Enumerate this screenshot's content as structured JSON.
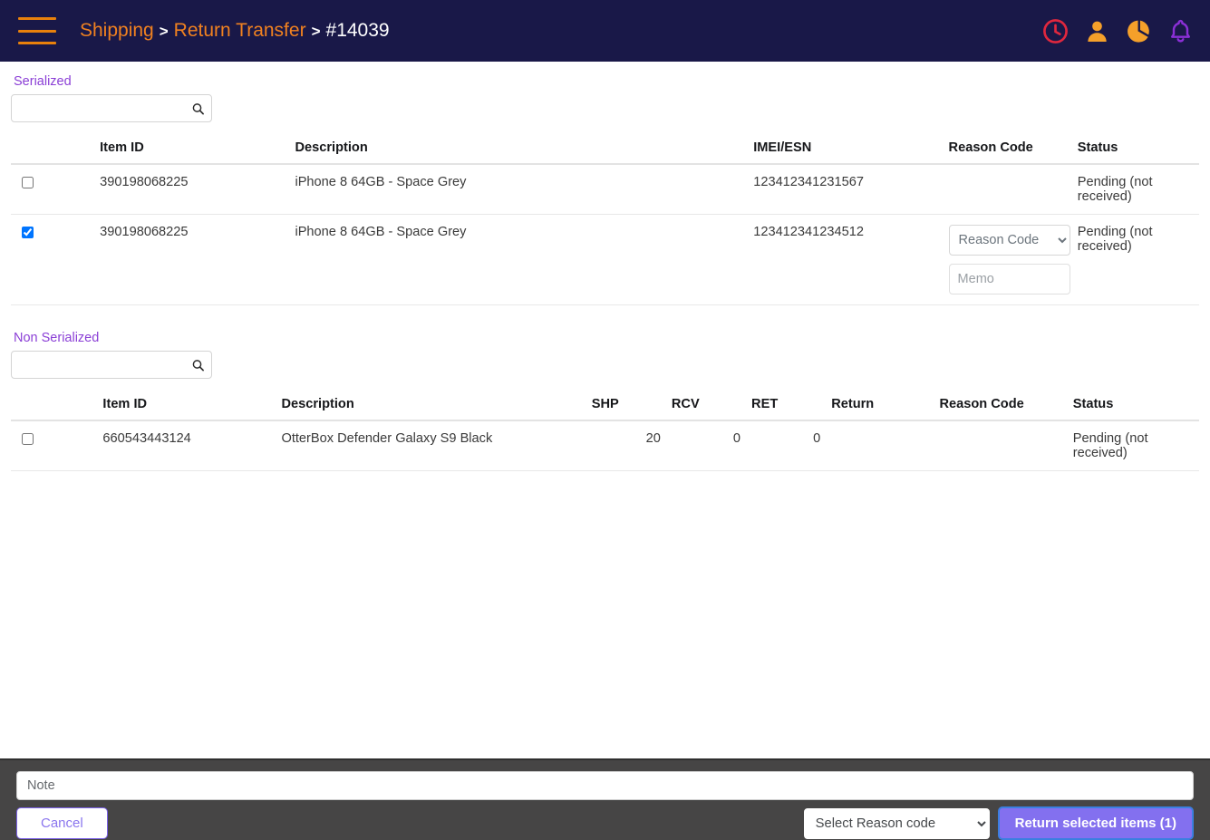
{
  "header": {
    "menu_icon": "hamburger-menu-icon",
    "breadcrumb": {
      "item1": "Shipping",
      "sep1": ">",
      "item2": "Return Transfer",
      "sep2": ">",
      "current": "#14039"
    },
    "icons": [
      {
        "name": "clock-icon",
        "color": "#e0273e"
      },
      {
        "name": "user-icon",
        "color": "#f5a02a"
      },
      {
        "name": "pie-chart-icon",
        "color": "#f5a02a"
      },
      {
        "name": "bell-icon",
        "color": "#8b2fd6"
      }
    ]
  },
  "serialized": {
    "label": "Serialized",
    "search_placeholder": "",
    "search_value": "",
    "columns": [
      "",
      "Item ID",
      "Description",
      "IMEI/ESN",
      "Reason Code",
      "Status"
    ],
    "rows": [
      {
        "checked": false,
        "item_id": "390198068225",
        "description": "iPhone 8 64GB - Space Grey",
        "imei": "123412341231567",
        "reason_code": "",
        "has_reason_control": false,
        "status": "Pending (not received)"
      },
      {
        "checked": true,
        "item_id": "390198068225",
        "description": "iPhone 8 64GB - Space Grey",
        "imei": "123412341234512",
        "reason_code": "Reason Code",
        "memo_placeholder": "Memo",
        "memo_value": "",
        "has_reason_control": true,
        "status": "Pending (not received)"
      }
    ]
  },
  "non_serialized": {
    "label": "Non Serialized",
    "search_placeholder": "",
    "search_value": "",
    "columns": [
      "",
      "Item ID",
      "Description",
      "SHP",
      "RCV",
      "RET",
      "Return",
      "Reason Code",
      "Status"
    ],
    "rows": [
      {
        "checked": false,
        "item_id": "660543443124",
        "description": "OtterBox Defender Galaxy S9 Black",
        "shp": "20",
        "rcv": "0",
        "ret": "0",
        "return_val": "",
        "reason_code": "",
        "status": "Pending (not received)"
      }
    ]
  },
  "footer": {
    "note_placeholder": "Note",
    "note_value": "",
    "cancel_label": "Cancel",
    "reason_select_label": "Select Reason code",
    "return_button_label": "Return selected items (1)"
  },
  "colors": {
    "header_bg": "#191848",
    "accent_orange": "#f08120",
    "accent_purple": "#8b3fd6",
    "footer_bg": "#464545",
    "button_purple": "#8370ef"
  }
}
